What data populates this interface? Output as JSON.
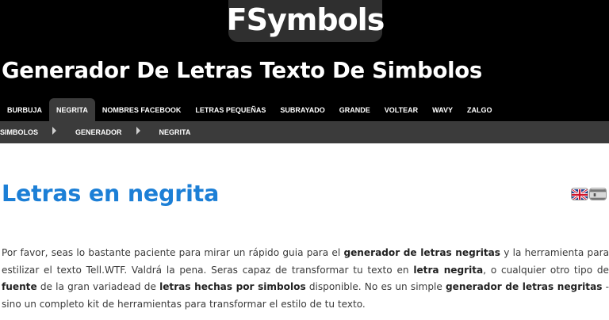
{
  "header": {
    "logo_text": "FSymbols",
    "site_title": "Generador De Letras Texto De Simbolos"
  },
  "nav": {
    "items": [
      {
        "label": "Burbuja",
        "active": false
      },
      {
        "label": "Negrita",
        "active": true
      },
      {
        "label": "Nombres Facebook",
        "active": false
      },
      {
        "label": "Letras Pequeñas",
        "active": false
      },
      {
        "label": "Subrayado",
        "active": false
      },
      {
        "label": "Grande",
        "active": false
      },
      {
        "label": "Voltear",
        "active": false
      },
      {
        "label": "Wavy",
        "active": false
      },
      {
        "label": "Zalgo",
        "active": false
      }
    ]
  },
  "breadcrumb": [
    "Simbolos",
    "Generador",
    "Negrita"
  ],
  "main": {
    "heading_strong": "Letras",
    "heading_rest": " en negrita",
    "language_flags": [
      "uk-flag",
      "spain-flag"
    ],
    "paragraph": [
      {
        "t": "Por favor, seas lo bastante paciente para mirar un rápido guia para el ",
        "b": false
      },
      {
        "t": "generador de letras negritas",
        "b": true
      },
      {
        "t": " y la herramienta para estilizar el texto Tell.WTF. Valdrá la pena. Seras capaz de transformar tu texto en ",
        "b": false
      },
      {
        "t": "letra negrita",
        "b": true
      },
      {
        "t": ", o cualquier otro tipo de ",
        "b": false
      },
      {
        "t": "fuente",
        "b": true
      },
      {
        "t": " de la gran variadead de ",
        "b": false
      },
      {
        "t": "le­tras hechas por simbolos",
        "b": true
      },
      {
        "t": " disponible. No es un simple ",
        "b": false
      },
      {
        "t": "generador de letras negritas",
        "b": true
      },
      {
        "t": " - sino un completo kit de herramientas para trans­formar el estilo de tu texto.",
        "b": false
      }
    ]
  },
  "colors": {
    "header_bg": "#000000",
    "bar_bg": "#3b3b3b",
    "heading_blue": "#1c7fd6"
  }
}
